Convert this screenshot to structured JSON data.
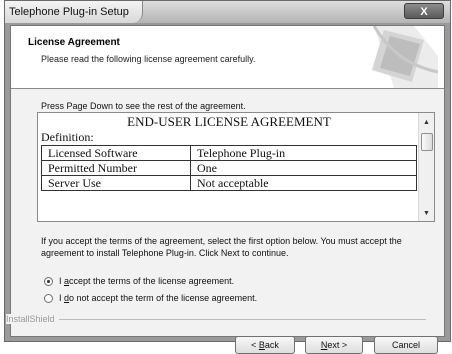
{
  "window": {
    "title": "Telephone Plug-in Setup",
    "close_label": "X"
  },
  "header": {
    "title": "License Agreement",
    "subtitle": "Please read the following license agreement carefully."
  },
  "hint": "Press Page Down to see the rest of the agreement.",
  "license": {
    "heading": "END-USER LICENSE AGREEMENT",
    "definition_label": "Definition:",
    "rows": [
      [
        "Licensed Software",
        "Telephone Plug-in"
      ],
      [
        "Permitted Number",
        "One"
      ],
      [
        "Server Use",
        "Not acceptable"
      ]
    ],
    "scroll_fraction": 0.1
  },
  "instructions": "If you accept the terms of the agreement, select the first option below. You must accept the agreement to install Telephone Plug-in. Click Next to continue.",
  "options": [
    {
      "label_pre": "I ",
      "label_key": "a",
      "label_post": "ccept the terms of the license agreement.",
      "selected": true
    },
    {
      "label_pre": "I ",
      "label_key": "d",
      "label_post": "o not accept the term of the license agreement.",
      "selected": false
    }
  ],
  "brand_label": "InstallShield",
  "buttons": {
    "back_pre": "< ",
    "back_key": "B",
    "back_post": "ack",
    "next_key": "N",
    "next_post": "ext >",
    "cancel": "Cancel"
  }
}
